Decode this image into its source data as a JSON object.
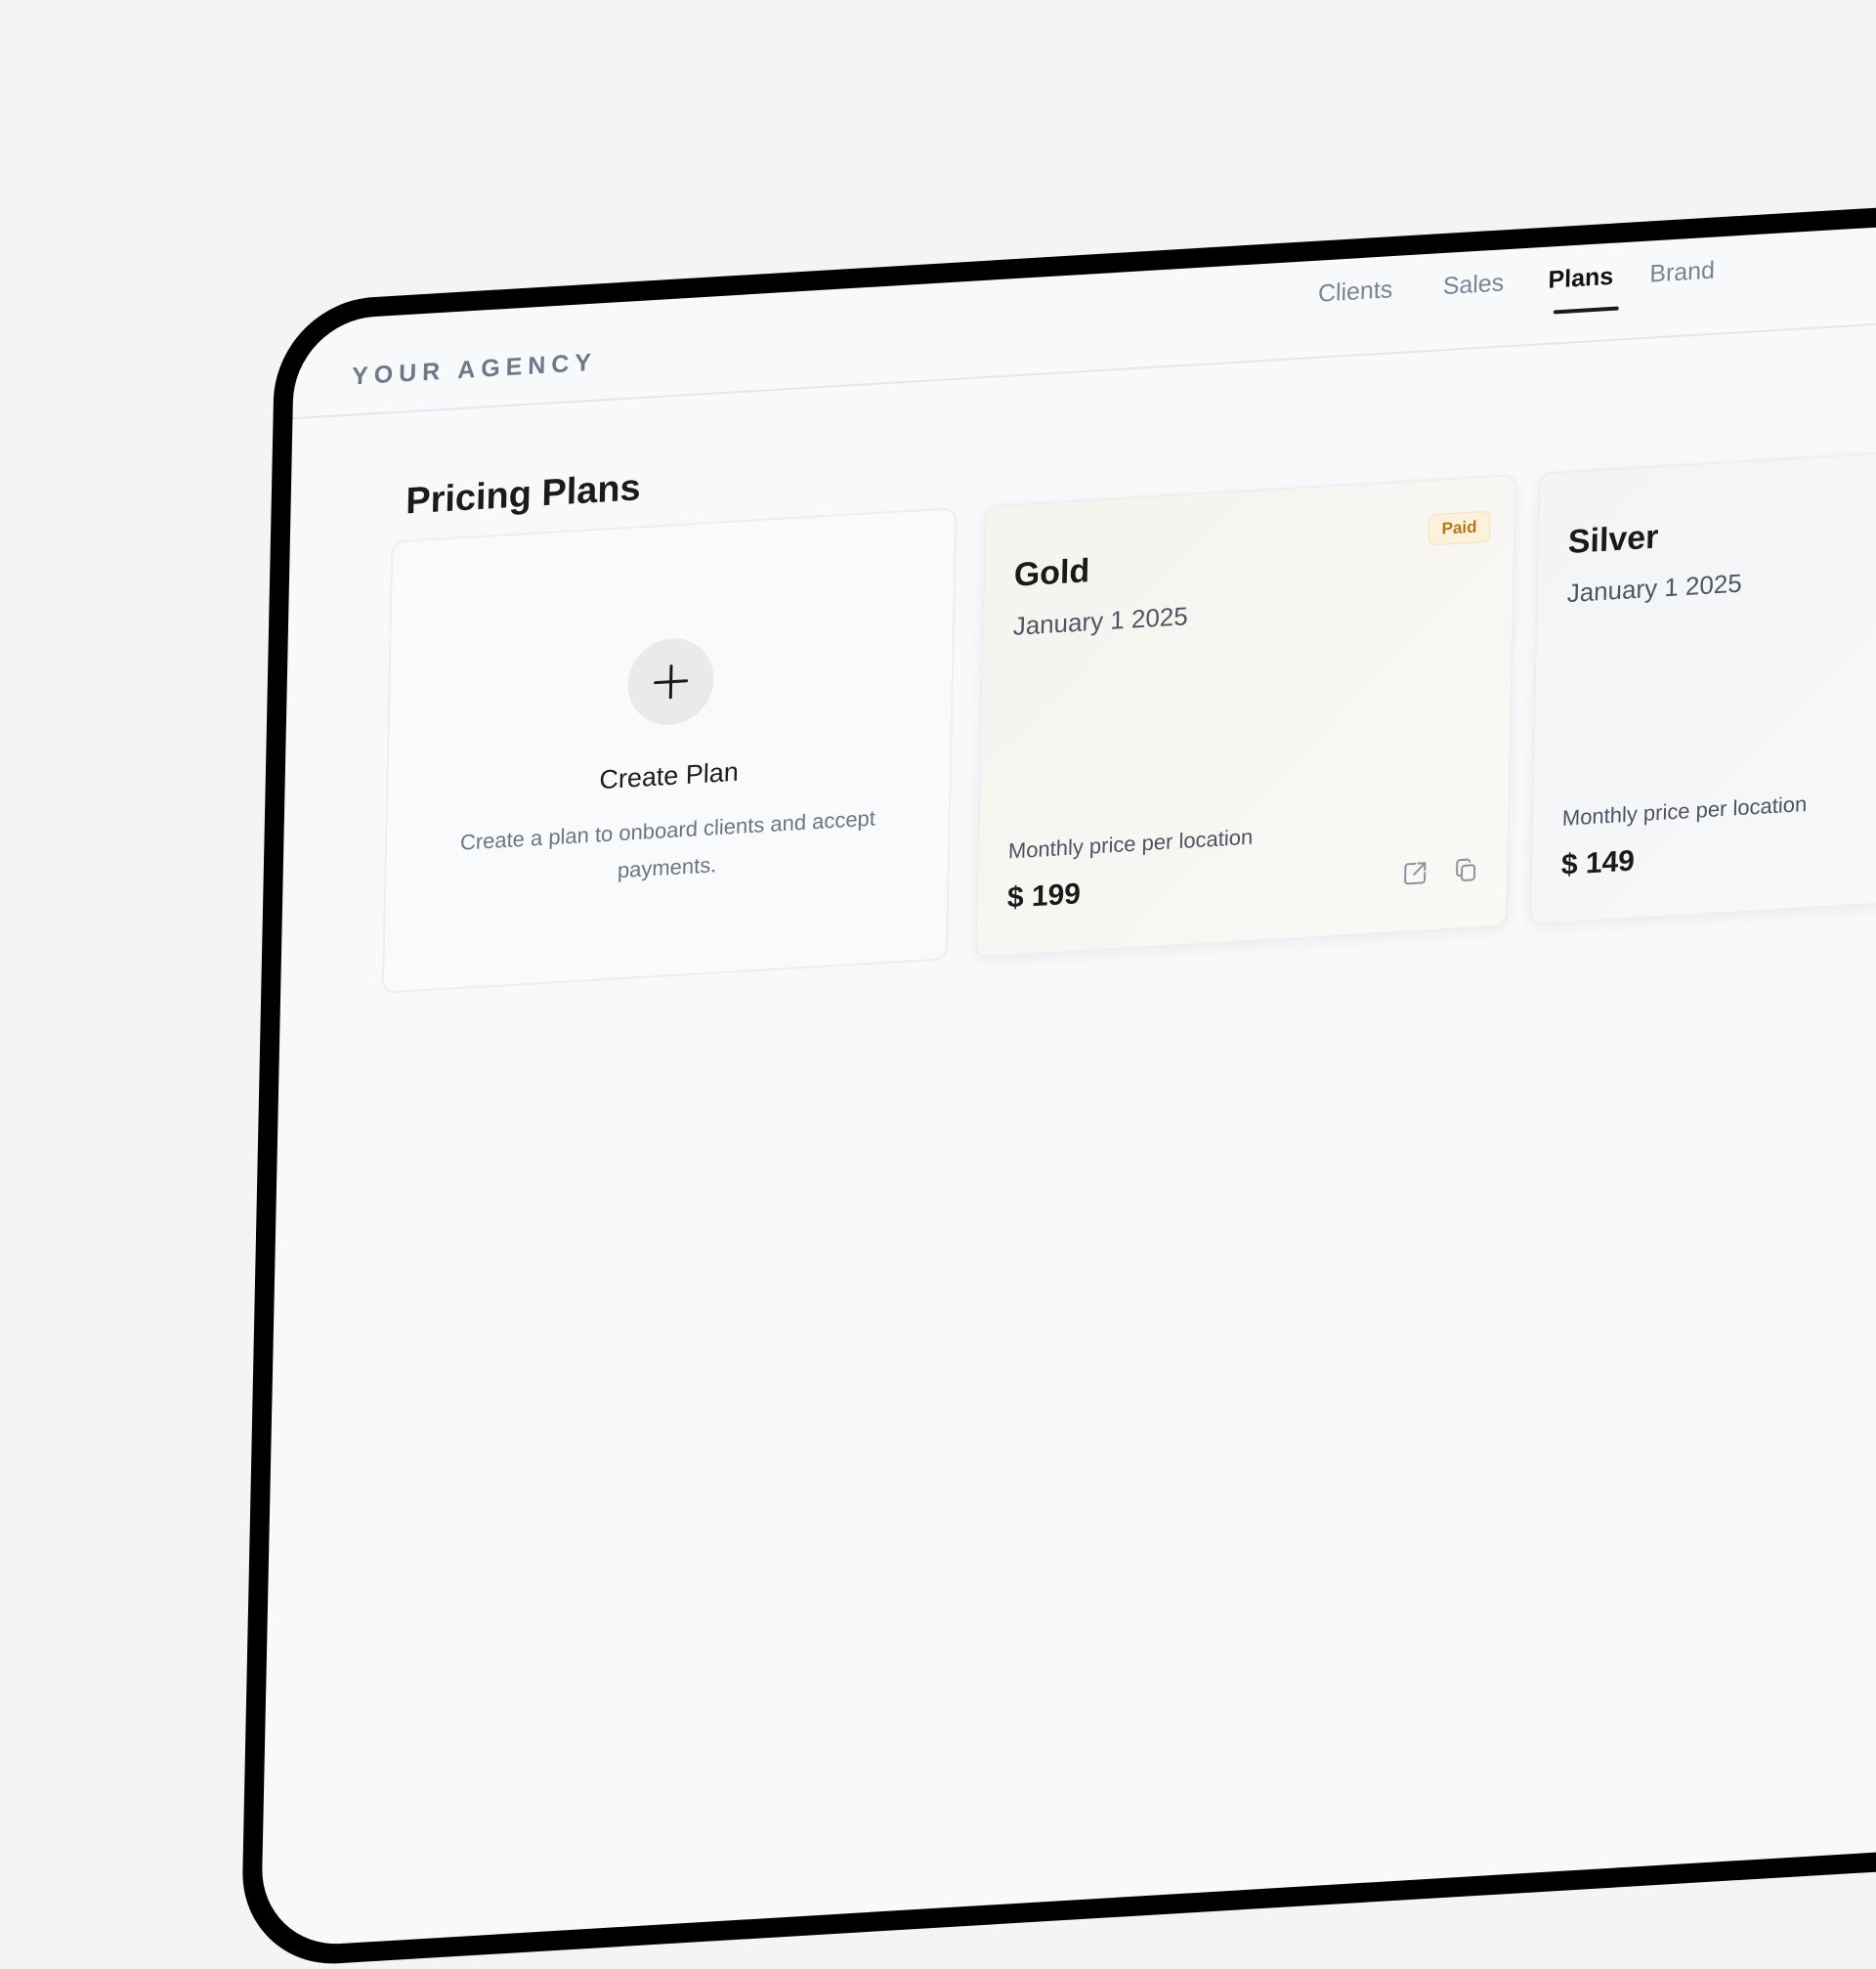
{
  "app": {
    "logo": "YOUR AGENCY"
  },
  "nav": {
    "items": [
      {
        "label": "Clients",
        "active": false
      },
      {
        "label": "Sales",
        "active": false
      },
      {
        "label": "Plans",
        "active": true
      },
      {
        "label": "Brand",
        "active": false
      }
    ]
  },
  "page": {
    "title": "Pricing Plans"
  },
  "create_card": {
    "icon": "plus-icon",
    "title": "Create Plan",
    "description": "Create a plan to onboard clients and accept payments."
  },
  "plans": [
    {
      "name": "Gold",
      "date": "January 1 2025",
      "badge": "Paid",
      "price_label": "Monthly price per location",
      "price": "$ 199",
      "actions": [
        "external-link-icon",
        "copy-icon"
      ]
    },
    {
      "name": "Silver",
      "date": "January 1 2025",
      "price_label": "Monthly price per location",
      "price": "$ 149"
    }
  ],
  "colors": {
    "background": "#f4f4f4",
    "screen": "#f7f9fa",
    "frame": "#000000",
    "badge_text": "#b07a1a",
    "badge_bg": "#fdf1dc"
  }
}
